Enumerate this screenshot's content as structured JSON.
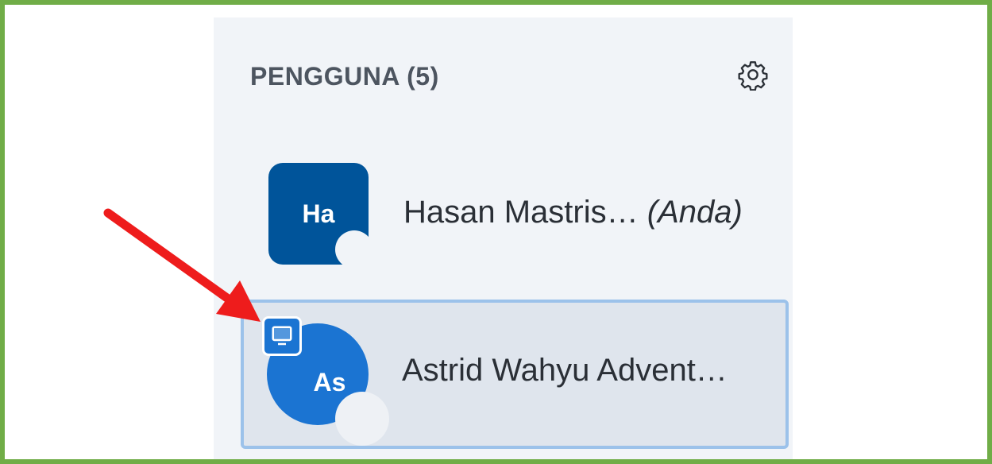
{
  "panel": {
    "title": "PENGGUNA (5)",
    "settings_icon": "gear-icon"
  },
  "users": [
    {
      "initials": "Ha",
      "name": "Hasan Mastris…",
      "you_label": "(Anda)",
      "avatar_color": "#00549a",
      "avatar_shape": "rounded-square"
    },
    {
      "initials": "As",
      "name": "Astrid Wahyu Advent…",
      "avatar_color": "#1b74d2",
      "avatar_shape": "circle",
      "badge_icon": "presenter-screen-icon",
      "selected": true
    }
  ],
  "annotation": {
    "arrow_color": "#ee1c1c",
    "frame_color": "#70ad47"
  }
}
